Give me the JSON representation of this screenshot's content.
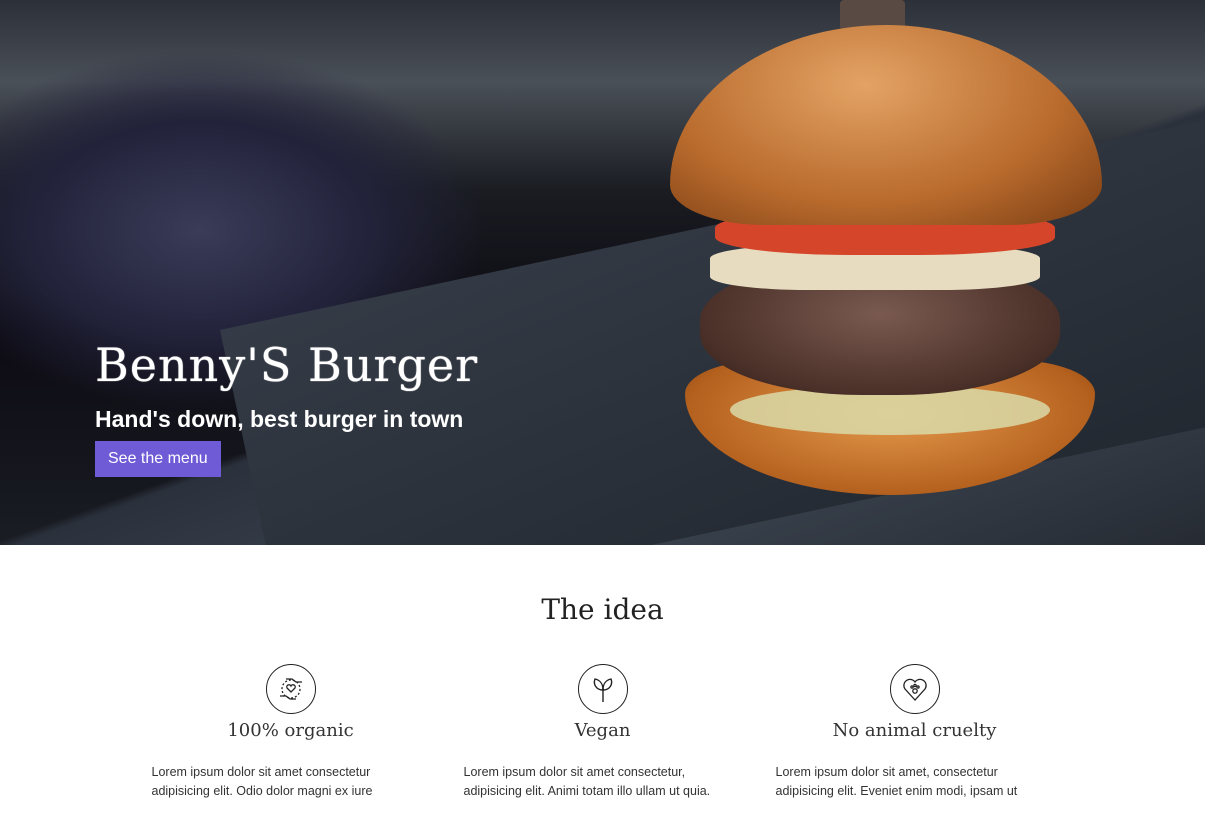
{
  "hero": {
    "title": "Benny'S Burger",
    "subtitle": "Hand's down, best burger in town",
    "button": "See the menu",
    "accent": "#6f5bd6"
  },
  "idea": {
    "heading": "The idea",
    "features": [
      {
        "icon": "hands-heart-icon",
        "title": "100% organic",
        "text": "Lorem ipsum dolor sit amet consectetur adipisicing elit. Odio dolor magni ex iure"
      },
      {
        "icon": "sprout-icon",
        "title": "Vegan",
        "text": "Lorem ipsum dolor sit amet consectetur, adipisicing elit. Animi totam illo ullam ut quia."
      },
      {
        "icon": "heart-paw-icon",
        "title": "No animal cruelty",
        "text": "Lorem ipsum dolor sit amet, consectetur adipisicing elit. Eveniet enim modi, ipsam ut"
      }
    ]
  }
}
